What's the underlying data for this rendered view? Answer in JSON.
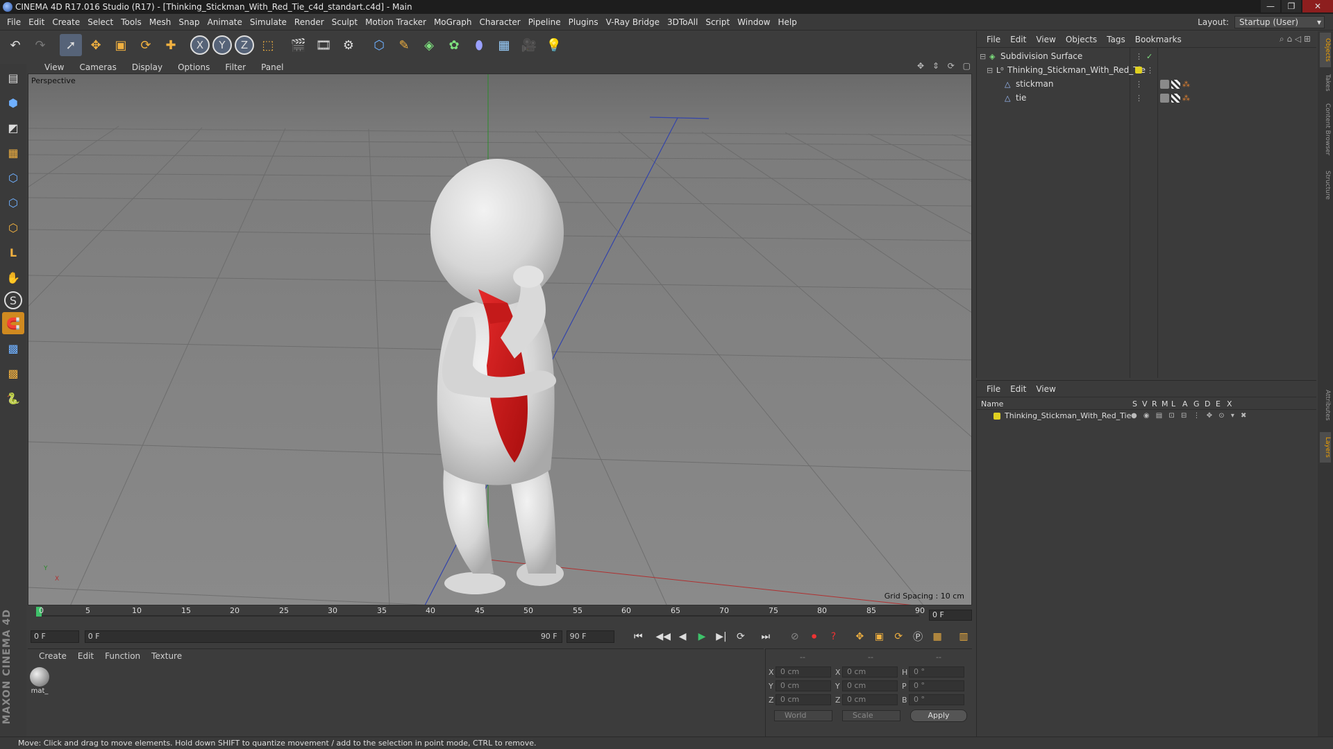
{
  "window": {
    "title": "CINEMA 4D R17.016 Studio (R17) - [Thinking_Stickman_With_Red_Tie_c4d_standart.c4d] - Main",
    "buttons": [
      "—",
      "❐",
      "✕"
    ]
  },
  "menubar": {
    "items": [
      "File",
      "Edit",
      "Create",
      "Select",
      "Tools",
      "Mesh",
      "Snap",
      "Animate",
      "Simulate",
      "Render",
      "Sculpt",
      "Motion Tracker",
      "MoGraph",
      "Character",
      "Pipeline",
      "Plugins",
      "V-Ray Bridge",
      "3DToAll",
      "Script",
      "Window",
      "Help"
    ],
    "layout_label": "Layout:",
    "layout_value": "Startup (User)"
  },
  "toolbar": {
    "icons": [
      "undo-icon",
      "redo-icon",
      "live-selection-icon",
      "move-icon",
      "scale-icon",
      "rotate-icon",
      "multi-tool-icon",
      "x-axis-icon",
      "y-axis-icon",
      "z-axis-icon",
      "world-coordinate-icon",
      "render-view-icon",
      "render-picture-viewer-icon",
      "edit-render-settings-icon",
      "cube-icon",
      "pen-spline-icon",
      "subdivision-icon",
      "array-icon",
      "deformer-icon",
      "floor-icon",
      "camera-icon",
      "light-icon"
    ],
    "glyphs": [
      "↶",
      "↷",
      "➚",
      "✥",
      "▣",
      "⟳",
      "✚",
      "X",
      "Y",
      "Z",
      "⬚",
      "🎬",
      "🎞",
      "⚙",
      "⬡",
      "✎",
      "◈",
      "✿",
      "⬮",
      "▦",
      "🎥",
      "💡"
    ]
  },
  "lefttoolbar": {
    "icons": [
      "make-editable-icon",
      "model-mode-icon",
      "texture-mode-icon",
      "workplane-icon",
      "points-mode-icon",
      "edges-mode-icon",
      "polygons-mode-icon",
      "axis-icon",
      "tweak-icon",
      "snap-icon",
      "magnet-icon",
      "grid-snap-icon",
      "enable-snap-icon",
      "python-icon"
    ],
    "glyphs": [
      "▤",
      "⬢",
      "◩",
      "▦",
      "⬡",
      "⬡",
      "⬡",
      "L",
      "✋",
      "S",
      "🧲",
      "▩",
      "▩",
      "🐍"
    ],
    "brand": "MAXON CINEMA 4D"
  },
  "viewport": {
    "menu": [
      "View",
      "Cameras",
      "Display",
      "Options",
      "Filter",
      "Panel"
    ],
    "camera": "Perspective",
    "grid_spacing": "Grid Spacing : 10 cm",
    "axis_y": "Y",
    "axis_x": "X"
  },
  "timeline": {
    "ticks": [
      "0",
      "5",
      "10",
      "15",
      "20",
      "25",
      "30",
      "35",
      "40",
      "45",
      "50",
      "55",
      "60",
      "65",
      "70",
      "75",
      "80",
      "85",
      "90"
    ],
    "current_frame": "0 F",
    "start": "0 F",
    "range_start": "0 F",
    "range_end": "90 F",
    "end": "90 F"
  },
  "transport": {
    "glyphs": [
      "⏮",
      "◀◀",
      "◀",
      "▶",
      "▶|",
      "⟳",
      "⏭"
    ],
    "icons": [
      "go-to-start-icon",
      "previous-key-icon",
      "previous-frame-icon",
      "play-icon",
      "next-frame-icon",
      "next-key-icon",
      "go-to-end-icon"
    ]
  },
  "materials": {
    "menu": [
      "Create",
      "Edit",
      "Function",
      "Texture"
    ],
    "items": [
      {
        "name": "mat_"
      }
    ]
  },
  "coordinates": {
    "headers": [
      "--",
      "--",
      "--"
    ],
    "rows": [
      {
        "a": "X",
        "av": "0 cm",
        "b": "X",
        "bv": "0 cm",
        "c": "H",
        "cv": "0 °"
      },
      {
        "a": "Y",
        "av": "0 cm",
        "b": "Y",
        "bv": "0 cm",
        "c": "P",
        "cv": "0 °"
      },
      {
        "a": "Z",
        "av": "0 cm",
        "b": "Z",
        "bv": "0 cm",
        "c": "B",
        "cv": "0 °"
      }
    ],
    "mode": "World",
    "size": "Scale",
    "apply": "Apply"
  },
  "objects": {
    "menu": [
      "File",
      "Edit",
      "View",
      "Objects",
      "Tags",
      "Bookmarks"
    ],
    "items": [
      {
        "name": "Subdivision Surface",
        "indent": 0
      },
      {
        "name": "Thinking_Stickman_With_Red_Tie",
        "indent": 1
      },
      {
        "name": "stickman",
        "indent": 2
      },
      {
        "name": "tie",
        "indent": 2
      }
    ]
  },
  "layers": {
    "menu": [
      "File",
      "Edit",
      "View"
    ],
    "header": {
      "name": "Name",
      "cols": [
        "S",
        "V",
        "R",
        "M",
        "L",
        "A",
        "G",
        "D",
        "E",
        "X"
      ]
    },
    "items": [
      {
        "name": "Thinking_Stickman_With_Red_Tie"
      }
    ]
  },
  "side_tabs": [
    "Objects",
    "Takes",
    "Content Browser",
    "Structure",
    "Attributes",
    "Layers"
  ],
  "status": "Move: Click and drag to move elements. Hold down SHIFT to quantize movement / add to the selection in point mode, CTRL to remove."
}
